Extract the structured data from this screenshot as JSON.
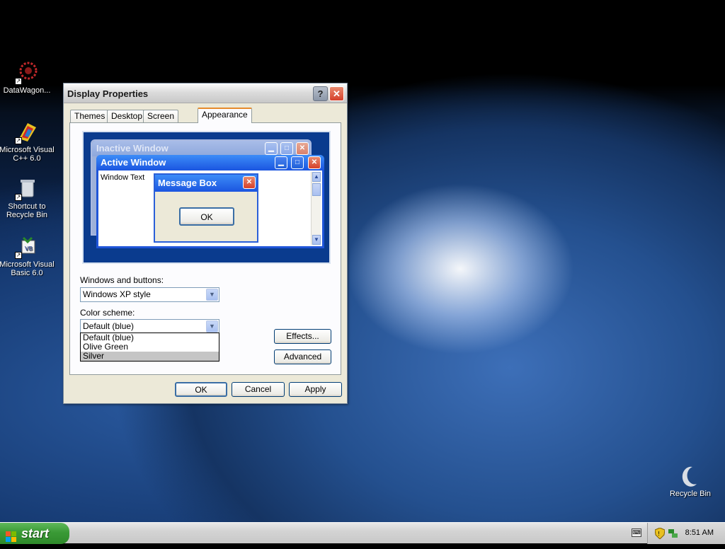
{
  "desktop": {
    "icons": [
      {
        "label": "DataWagon...",
        "icon": "datawagon-icon"
      },
      {
        "label": "Microsoft Visual C++ 6.0",
        "icon": "visual-cpp-icon"
      },
      {
        "label": "Shortcut to Recycle Bin",
        "icon": "recycle-bin-shortcut-icon"
      },
      {
        "label": "Microsoft Visual Basic 6.0",
        "icon": "visual-basic-icon"
      },
      {
        "label": "Recycle Bin",
        "icon": "recycle-bin-icon"
      }
    ]
  },
  "dialog": {
    "title": "Display Properties",
    "help_glyph": "?",
    "close_glyph": "✕",
    "tabs": [
      {
        "label": "Themes"
      },
      {
        "label": "Desktop"
      },
      {
        "label": "Screen Saver"
      },
      {
        "label": "Appearance",
        "active": true
      }
    ],
    "preview": {
      "inactive_title": "Inactive Window",
      "active_title": "Active Window",
      "window_text": "Window Text",
      "message_box_title": "Message Box",
      "message_box_ok": "OK"
    },
    "windows_buttons_label": "Windows and buttons:",
    "windows_buttons_value": "Windows XP style",
    "color_scheme_label": "Color scheme:",
    "color_scheme_value": "Default (blue)",
    "color_scheme_options": [
      "Default (blue)",
      "Olive Green",
      "Silver"
    ],
    "color_scheme_highlighted": "Silver",
    "effects_button": "Effects...",
    "advanced_button": "Advanced",
    "ok_button": "OK",
    "cancel_button": "Cancel",
    "apply_button": "Apply"
  },
  "taskbar": {
    "start_label": "start",
    "clock": "8:51 AM"
  },
  "colors": {
    "xp_blue": "#0a3b8e",
    "start_green": "#3a9a36",
    "silver_titlebar": "#dcdcdc"
  }
}
